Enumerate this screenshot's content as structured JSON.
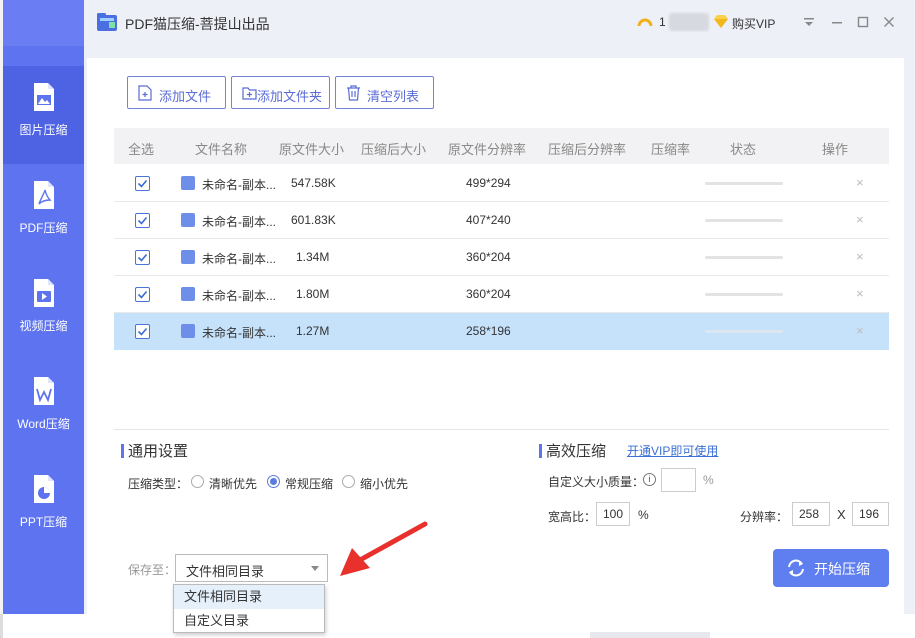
{
  "window": {
    "title": "PDF猫压缩-菩提山出品",
    "user_id": "1",
    "vip_label": "购买VIP",
    "minimize_icon": "minimize-icon",
    "maximize_icon": "maximize-icon",
    "close_icon": "close-icon"
  },
  "sidebar": {
    "items": [
      {
        "label": "图片压缩",
        "icon": "image-file-icon"
      },
      {
        "label": "PDF压缩",
        "icon": "pdf-file-icon"
      },
      {
        "label": "视频压缩",
        "icon": "video-file-icon"
      },
      {
        "label": "Word压缩",
        "icon": "word-file-icon"
      },
      {
        "label": "PPT压缩",
        "icon": "ppt-file-icon"
      }
    ],
    "active_index": 0
  },
  "toolbar": {
    "add_file": "添加文件",
    "add_folder": "添加文件夹",
    "clear_list": "清空列表"
  },
  "table": {
    "columns": [
      "全选",
      "文件名称",
      "原文件大小",
      "压缩后大小",
      "原文件分辨率",
      "压缩后分辨率",
      "压缩率",
      "状态",
      "操作"
    ],
    "rows": [
      {
        "name": "未命名-副本...",
        "size": "547.58K",
        "resolution": "499*294",
        "checked": true,
        "remove": "×"
      },
      {
        "name": "未命名-副本...",
        "size": "601.83K",
        "resolution": "407*240",
        "checked": true,
        "remove": "×"
      },
      {
        "name": "未命名-副本...",
        "size": "1.34M",
        "resolution": "360*204",
        "checked": true,
        "remove": "×"
      },
      {
        "name": "未命名-副本...",
        "size": "1.80M",
        "resolution": "360*204",
        "checked": true,
        "remove": "×"
      },
      {
        "name": "未命名-副本...",
        "size": "1.27M",
        "resolution": "258*196",
        "checked": true,
        "remove": "×"
      }
    ],
    "selected_row": 4
  },
  "general": {
    "title": "通用设置",
    "type_label": "压缩类型：",
    "options": [
      "清晰优先",
      "常规压缩",
      "缩小优先"
    ],
    "selected": "常规压缩"
  },
  "efficient": {
    "title": "高效压缩",
    "vip_link": "开通VIP即可使用",
    "quality_label": "自定义大小质量：",
    "quality_value": "",
    "percent": "%",
    "info_icon_text": "i",
    "ratio_label": "宽高比：",
    "ratio_value": "100",
    "resolution_label": "分辨率：",
    "width_value": "258",
    "times": "X",
    "height_value": "196"
  },
  "save": {
    "label": "保存至：",
    "selected": "文件相同目录",
    "options": [
      "文件相同目录",
      "自定义目录"
    ]
  },
  "start_button": "开始压缩",
  "colors": {
    "sidebar": "#5d73f0",
    "accent": "#5f7ef0",
    "arrow": "#e8312c",
    "selected_row": "#c6e2fb"
  }
}
